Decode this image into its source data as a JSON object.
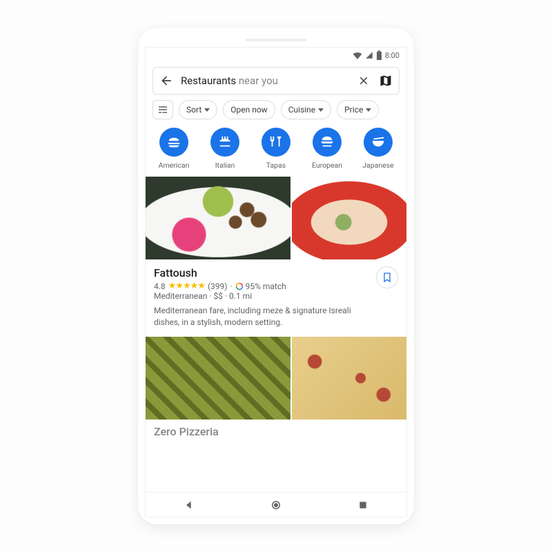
{
  "status": {
    "time": "8:00"
  },
  "search": {
    "term": "Restaurants",
    "suffix": " near you"
  },
  "filters": {
    "sort": "Sort",
    "open_now": "Open now",
    "cuisine": "Cuisine",
    "price": "Price"
  },
  "categories": [
    {
      "id": "american",
      "label": "American"
    },
    {
      "id": "italian",
      "label": "Italian"
    },
    {
      "id": "tapas",
      "label": "Tapas"
    },
    {
      "id": "european",
      "label": "European"
    },
    {
      "id": "japanese",
      "label": "Japanese"
    }
  ],
  "results": [
    {
      "name": "Fattoush",
      "rating": "4.8",
      "reviews": "(399)",
      "match": "95% match",
      "tags": "Mediterranean · $$ · 0.1 mi",
      "description": "Mediterranean fare, including meze & signature Isreali dishes, in a stylish, modern setting."
    },
    {
      "name": "Zero Pizzeria"
    }
  ]
}
